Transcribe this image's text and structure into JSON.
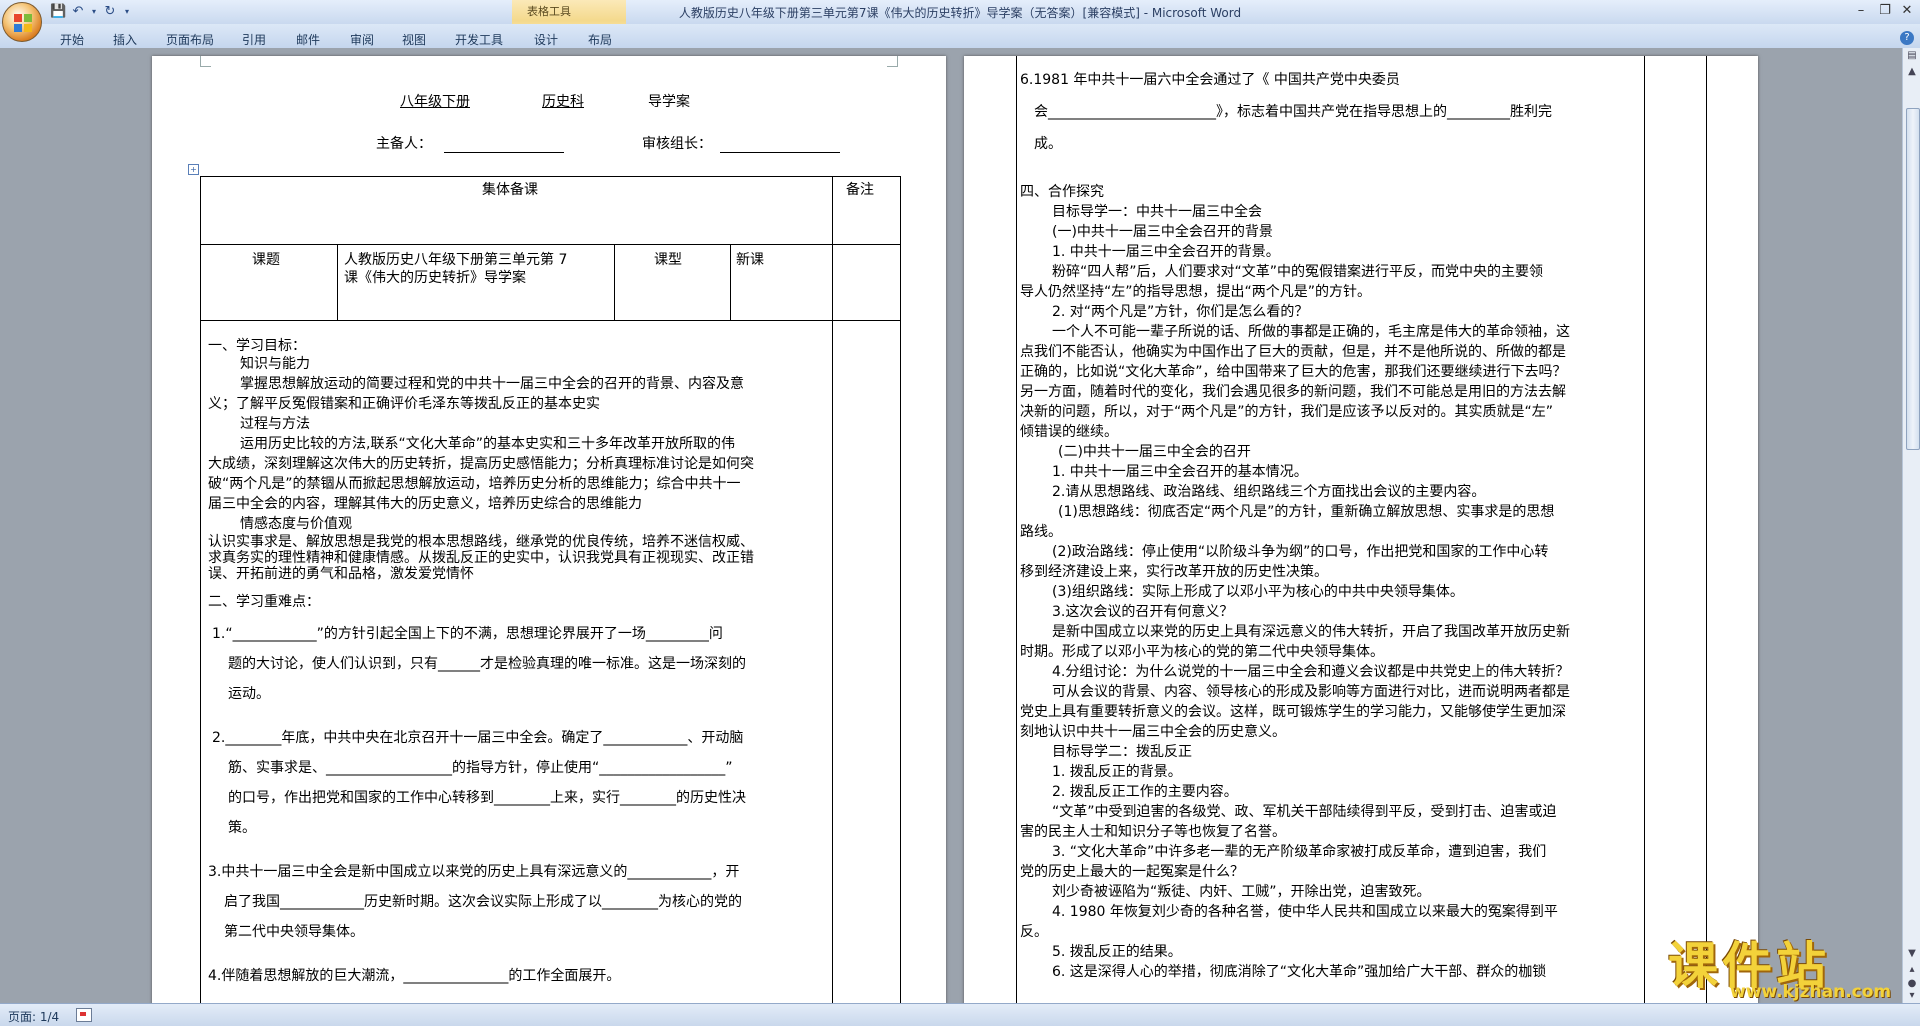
{
  "window": {
    "title": "人教版历史八年级下册第三单元第7课《伟大的历史转折》导学案（无答案）[兼容模式] - Microsoft Word",
    "context_tab_group": "表格工具"
  },
  "ribbon_tabs": [
    "开始",
    "插入",
    "页面布局",
    "引用",
    "邮件",
    "审阅",
    "视图",
    "开发工具",
    "设计",
    "布局"
  ],
  "status": {
    "page": "页面: 1/4"
  },
  "watermark": {
    "text": "课件站",
    "url": "www.kjzhan.com"
  },
  "page1": {
    "header": {
      "grade": "八年级下册",
      "subject": "历史科",
      "type": "导学案",
      "author_label": "主备人：",
      "reviewer_label": "审核组长："
    },
    "table": {
      "collective_label": "集体备课",
      "remark_label": "备注",
      "topic_label": "课题",
      "topic_line1": "人教版历史八年级下册第三单元第 7",
      "topic_line2": "课《伟大的历史转折》导学案",
      "lesson_type_label": "课型",
      "lesson_type": "新课"
    },
    "lines": [
      "一、学习目标：",
      "知识与能力",
      "掌握思想解放运动的简要过程和党的中共十一届三中全会的召开的背景、内容及意",
      "义；了解平反冤假错案和正确评价毛泽东等拨乱反正的基本史实",
      "过程与方法",
      "运用历史比较的方法,联系“文化大革命”的基本史实和三十多年改革开放所取的伟",
      "大成绩，深刻理解这次伟大的历史转折，提高历史感悟能力；分析真理标准讨论是如何突",
      "破“两个凡是”的禁锢从而掀起思想解放运动，培养历史分析的思维能力；综合中共十一",
      "届三中全会的内容，理解其伟大的历史意义，培养历史综合的思维能力",
      "情感态度与价值观",
      "认识实事求是、解放思想是我党的根本思想路线，继承党的优良传统，培养不迷信权威、",
      "求真务实的理性精神和健康情感。从拨乱反正的史实中，认识我党具有正视现实、改正错",
      "误、开拓前进的勇气和品格，激发爱党情怀",
      "二、学习重难点：",
      "1.“____________”的方针引起全国上下的不满，思想理论界展开了一场_________问",
      "题的大讨论，使人们认识到，只有______才是检验真理的唯一标准。这是一场深刻的",
      "运动。",
      "2.________年底，中共中央在北京召开十一届三中全会。确定了____________、开动脑",
      "筋、实事求是、__________________的指导方针，停止使用“__________________”",
      "的口号，作出把党和国家的工作中心转移到________上来，实行________的历史性决",
      "策。",
      "3.中共十一届三中全会是新中国成立以来党的历史上具有深远意义的____________，开",
      "启了我国____________历史新时期。这次会议实际上形成了以________为核心的党的",
      "第二代中央领导集体。",
      "4.伴随着思想解放的巨大潮流，_______________的工作全面展开。"
    ]
  },
  "page2": {
    "lines": [
      "6.1981 年中共十一届六中全会通过了《 中国共产党中央委员",
      "会________________________》，标志着中国共产党在指导思想上的_________胜利完",
      "成。",
      "四、合作探究",
      "目标导学一：中共十一届三中全会",
      "(一)中共十一届三中全会召开的背景",
      "1. 中共十一届三中全会召开的背景。",
      "粉碎“四人帮”后，人们要求对“文革”中的冤假错案进行平反，而党中央的主要领",
      "导人仍然坚持“左”的指导思想，提出“两个凡是”的方针。",
      "2. 对“两个凡是”方针，你们是怎么看的？",
      "一个人不可能一辈子所说的话、所做的事都是正确的，毛主席是伟大的革命领袖，这",
      "点我们不能否认，他确实为中国作出了巨大的贡献，但是，并不是他所说的、所做的都是",
      "正确的，比如说“文化大革命”，给中国带来了巨大的危害，那我们还要继续进行下去吗？",
      "另一方面，随着时代的变化，我们会遇见很多的新问题，我们不可能总是用旧的方法去解",
      "决新的问题，所以，对于“两个凡是”的方针，我们是应该予以反对的。其实质就是“左”",
      "倾错误的继续。",
      "(二)中共十一届三中全会的召开",
      "1. 中共十一届三中全会召开的基本情况。",
      "2.请从思想路线、政治路线、组织路线三个方面找出会议的主要内容。",
      "(1)思想路线：彻底否定“两个凡是”的方针，重新确立解放思想、实事求是的思想",
      "路线。",
      "(2)政治路线：停止使用“以阶级斗争为纲”的口号，作出把党和国家的工作中心转",
      "移到经济建设上来，实行改革开放的历史性决策。",
      "(3)组织路线：实际上形成了以邓小平为核心的中共中央领导集体。",
      "3.这次会议的召开有何意义？",
      "是新中国成立以来党的历史上具有深远意义的伟大转折，开启了我国改革开放历史新",
      "时期。形成了以邓小平为核心的党的第二代中央领导集体。",
      "4.分组讨论：为什么说党的十一届三中全会和遵义会议都是中共党史上的伟大转折？",
      "可从会议的背景、内容、领导核心的形成及影响等方面进行对比，进而说明两者都是",
      "党史上具有重要转折意义的会议。这样，既可锻炼学生的学习能力，又能够使学生更加深",
      "刻地认识中共十一届三中全会的历史意义。",
      "目标导学二：拨乱反正",
      "1. 拨乱反正的背景。",
      "2. 拨乱反正工作的主要内容。",
      "“文革”中受到迫害的各级党、政、军机关干部陆续得到平反，受到打击、迫害或迫",
      "害的民主人士和知识分子等也恢复了名誉。",
      "3. “文化大革命”中许多老一辈的无产阶级革命家被打成反革命，遭到迫害，我们",
      "党的历史上最大的一起冤案是什么？",
      "刘少奇被诬陷为“叛徒、内奸、工贼”，开除出党，迫害致死。",
      "4. 1980 年恢复刘少奇的各种名誉，使中华人民共和国成立以来最大的冤案得到平",
      "反。",
      "5. 拨乱反正的结果。",
      "6. 这是深得人心的举措，彻底消除了“文化大革命”强加给广大干部、群众的枷锁"
    ]
  }
}
